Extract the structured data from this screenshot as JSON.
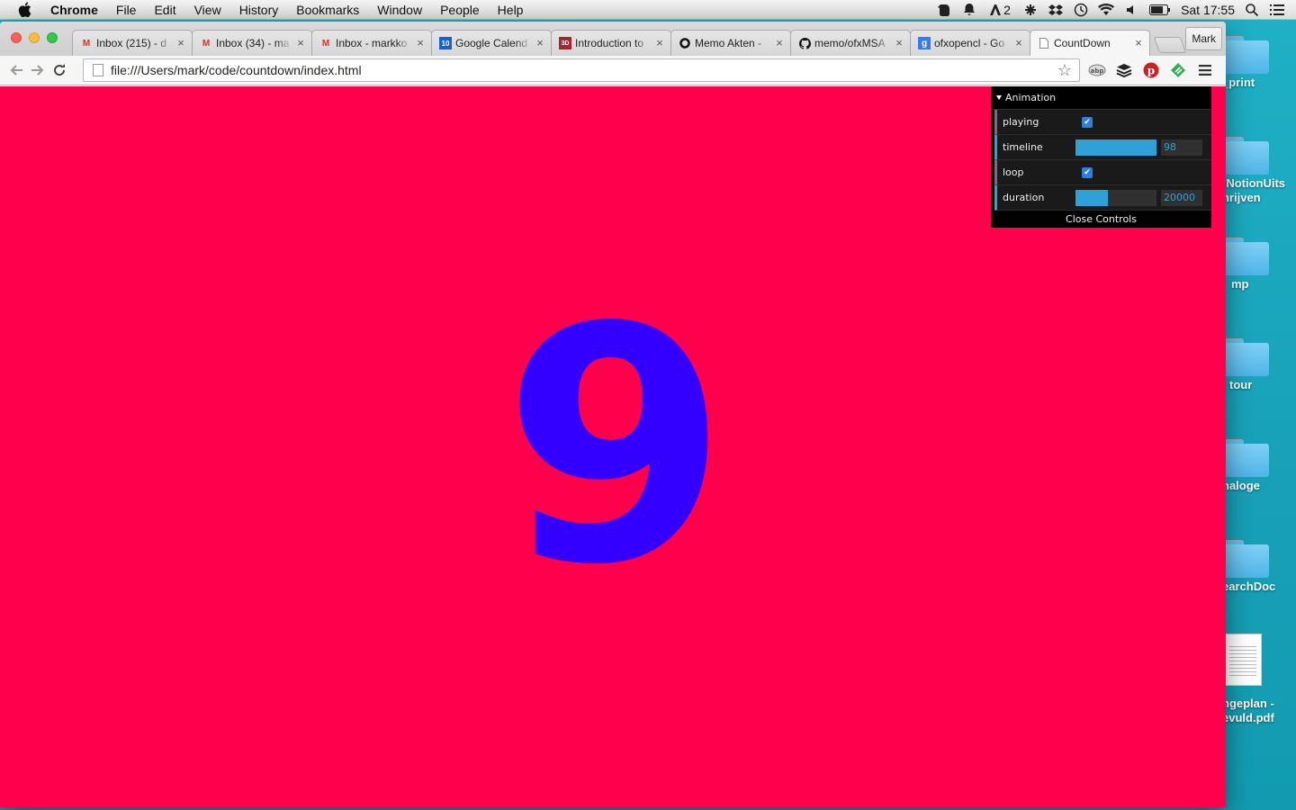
{
  "menubar": {
    "app_name": "Chrome",
    "menus": [
      "File",
      "Edit",
      "View",
      "History",
      "Bookmarks",
      "Window",
      "People",
      "Help"
    ],
    "status": {
      "notification_count": "2",
      "clock": "Sat 17:55"
    }
  },
  "desktop": {
    "items": [
      {
        "label": "_print",
        "kind": "folder"
      },
      {
        "label": ":NotionUits\nhrijven",
        "kind": "folder"
      },
      {
        "label": "mp",
        "kind": "folder"
      },
      {
        "label": "tour",
        "kind": "folder"
      },
      {
        "label": "naloge",
        "kind": "folder"
      },
      {
        "label": "earchDoc",
        "kind": "folder"
      },
      {
        "label": "ngeplan -\nevuld.pdf",
        "kind": "pdf"
      }
    ]
  },
  "browser": {
    "tabs": [
      {
        "title": "Inbox (215) - d",
        "favicon": "M",
        "favicon_color": "#d93025"
      },
      {
        "title": "Inbox (34) - ma",
        "favicon": "M",
        "favicon_color": "#d93025"
      },
      {
        "title": "Inbox - markko",
        "favicon": "M",
        "favicon_color": "#d93025"
      },
      {
        "title": "Google Calend",
        "favicon": "10",
        "favicon_color": "#1a5fd0"
      },
      {
        "title": "Introduction to",
        "favicon": "3D",
        "favicon_color": "#a0282c"
      },
      {
        "title": "Memo Akten - ",
        "favicon": "O",
        "favicon_color": "#111111"
      },
      {
        "title": "memo/ofxMSA",
        "favicon": "gh",
        "favicon_color": "#111111"
      },
      {
        "title": "ofxopencl - Go",
        "favicon": "g",
        "favicon_color": "#3b7be8"
      },
      {
        "title": "CountDown",
        "favicon": "doc",
        "favicon_color": "#888888"
      }
    ],
    "profile_name": "Mark",
    "url": "file:///Users/mark/code/countdown/index.html"
  },
  "page": {
    "background_color": "#ff004c",
    "digit": "9",
    "digit_color": "#3300ff"
  },
  "gui": {
    "folder_title": "Animation",
    "controls": [
      {
        "label": "playing",
        "type": "checkbox",
        "checked": true
      },
      {
        "label": "timeline",
        "type": "slider",
        "value": "98",
        "fraction": 1.0
      },
      {
        "label": "loop",
        "type": "checkbox",
        "checked": true
      },
      {
        "label": "duration",
        "type": "slider",
        "value": "20000",
        "fraction": 0.4
      }
    ],
    "close_label": "Close Controls",
    "accent_color": "#2fa1d6"
  }
}
